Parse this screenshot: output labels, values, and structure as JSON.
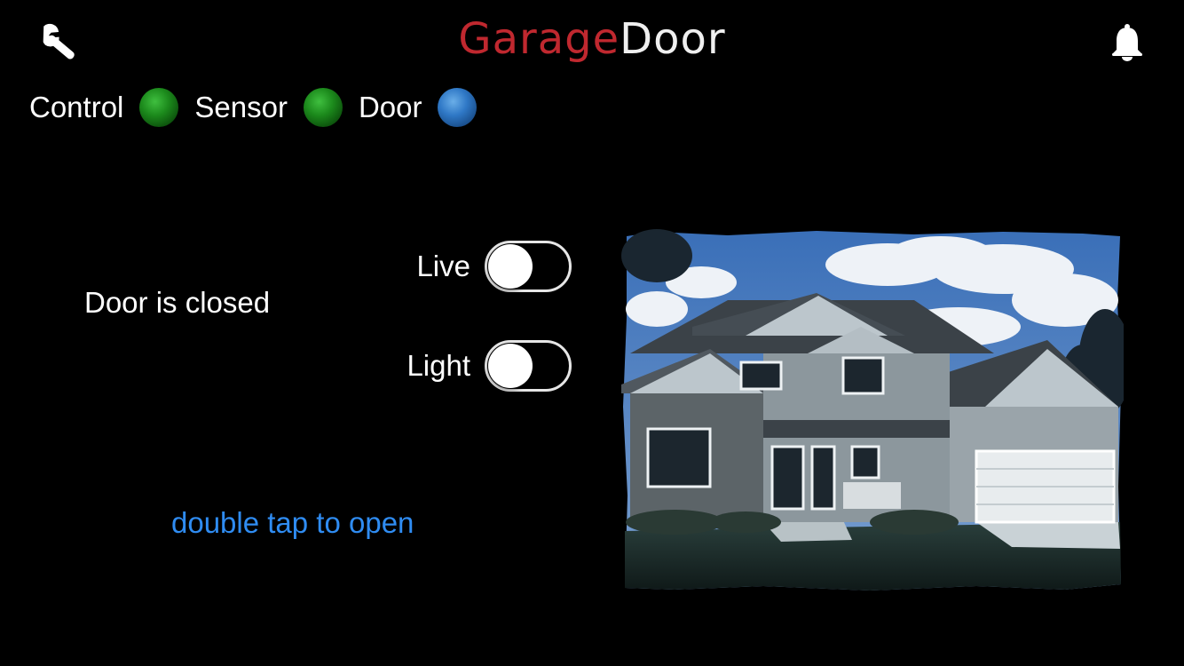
{
  "header": {
    "title_part1": "Garage",
    "title_part2": "Door",
    "settings_icon": "wrench-icon",
    "notifications_icon": "bell-icon"
  },
  "status": [
    {
      "label": "Control",
      "state_color": "#1c8a1c"
    },
    {
      "label": "Sensor",
      "state_color": "#1c8a1c"
    },
    {
      "label": "Door",
      "state_color": "#2f78c6"
    }
  ],
  "door_state": "Door is closed",
  "toggles": {
    "live": {
      "label": "Live",
      "on": false
    },
    "light": {
      "label": "Light",
      "on": false
    }
  },
  "action_hint": "double tap to open",
  "colors": {
    "background": "#000000",
    "title_accent": "#c0282f",
    "link": "#2f8cf2"
  }
}
